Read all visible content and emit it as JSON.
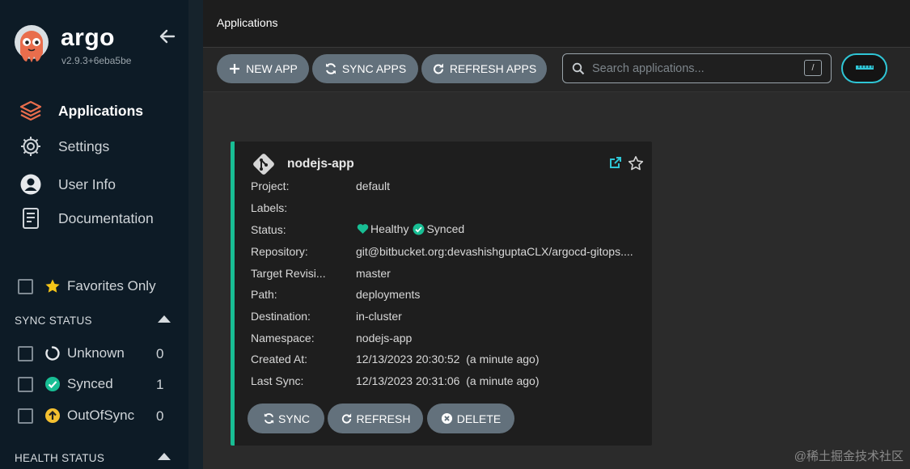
{
  "colors": {
    "accent": "#18be94",
    "sidebar_bg": "#0d1b26",
    "button_bg": "#63717c",
    "toggle_border": "#2fc6d6",
    "brand_orange": "#e96d4c"
  },
  "sidebar": {
    "brand": "argo",
    "version": "v2.9.3+6eba5be",
    "logo_icon": "argo-octopus-logo",
    "collapse_icon": "arrow-left-icon",
    "nav": [
      {
        "label": "Applications",
        "icon": "layers-icon",
        "active": true
      },
      {
        "label": "Settings",
        "icon": "gear-icon",
        "active": false
      },
      {
        "label": "User Info",
        "icon": "user-circle-icon",
        "active": false
      },
      {
        "label": "Documentation",
        "icon": "document-icon",
        "active": false
      }
    ],
    "favorites": {
      "label": "Favorites Only",
      "icon": "star-icon",
      "checked": false
    },
    "sync_status": {
      "title": "SYNC STATUS",
      "items": [
        {
          "label": "Unknown",
          "count": "0",
          "icon": "circle-notch-icon"
        },
        {
          "label": "Synced",
          "count": "1",
          "icon": "check-circle-icon"
        },
        {
          "label": "OutOfSync",
          "count": "0",
          "icon": "arrow-up-circle-icon"
        }
      ]
    },
    "health_status": {
      "title": "HEALTH STATUS"
    }
  },
  "topbar": {
    "title": "Applications"
  },
  "toolbar": {
    "new_app": "NEW APP",
    "sync_apps": "SYNC APPS",
    "refresh_apps": "REFRESH APPS",
    "search_placeholder": "Search applications...",
    "search_shortcut": "/"
  },
  "app_card": {
    "name": "nodejs-app",
    "rows": [
      {
        "label": "Project:",
        "value": "default"
      },
      {
        "label": "Labels:",
        "value": ""
      },
      {
        "label": "Status:",
        "value": ""
      },
      {
        "label": "Repository:",
        "value": "git@bitbucket.org:devashishguptaCLX/argocd-gitops...."
      },
      {
        "label": "Target Revisi...",
        "value": "master"
      },
      {
        "label": "Path:",
        "value": "deployments"
      },
      {
        "label": "Destination:",
        "value": "in-cluster"
      },
      {
        "label": "Namespace:",
        "value": "nodejs-app"
      },
      {
        "label": "Created At:",
        "value": "12/13/2023 20:30:52  (a minute ago)"
      },
      {
        "label": "Last Sync:",
        "value": "12/13/2023 20:31:06  (a minute ago)"
      }
    ],
    "health": "Healthy",
    "sync": "Synced",
    "buttons": {
      "sync": "SYNC",
      "refresh": "REFRESH",
      "delete": "DELETE"
    }
  },
  "watermark": "@稀土掘金技术社区"
}
